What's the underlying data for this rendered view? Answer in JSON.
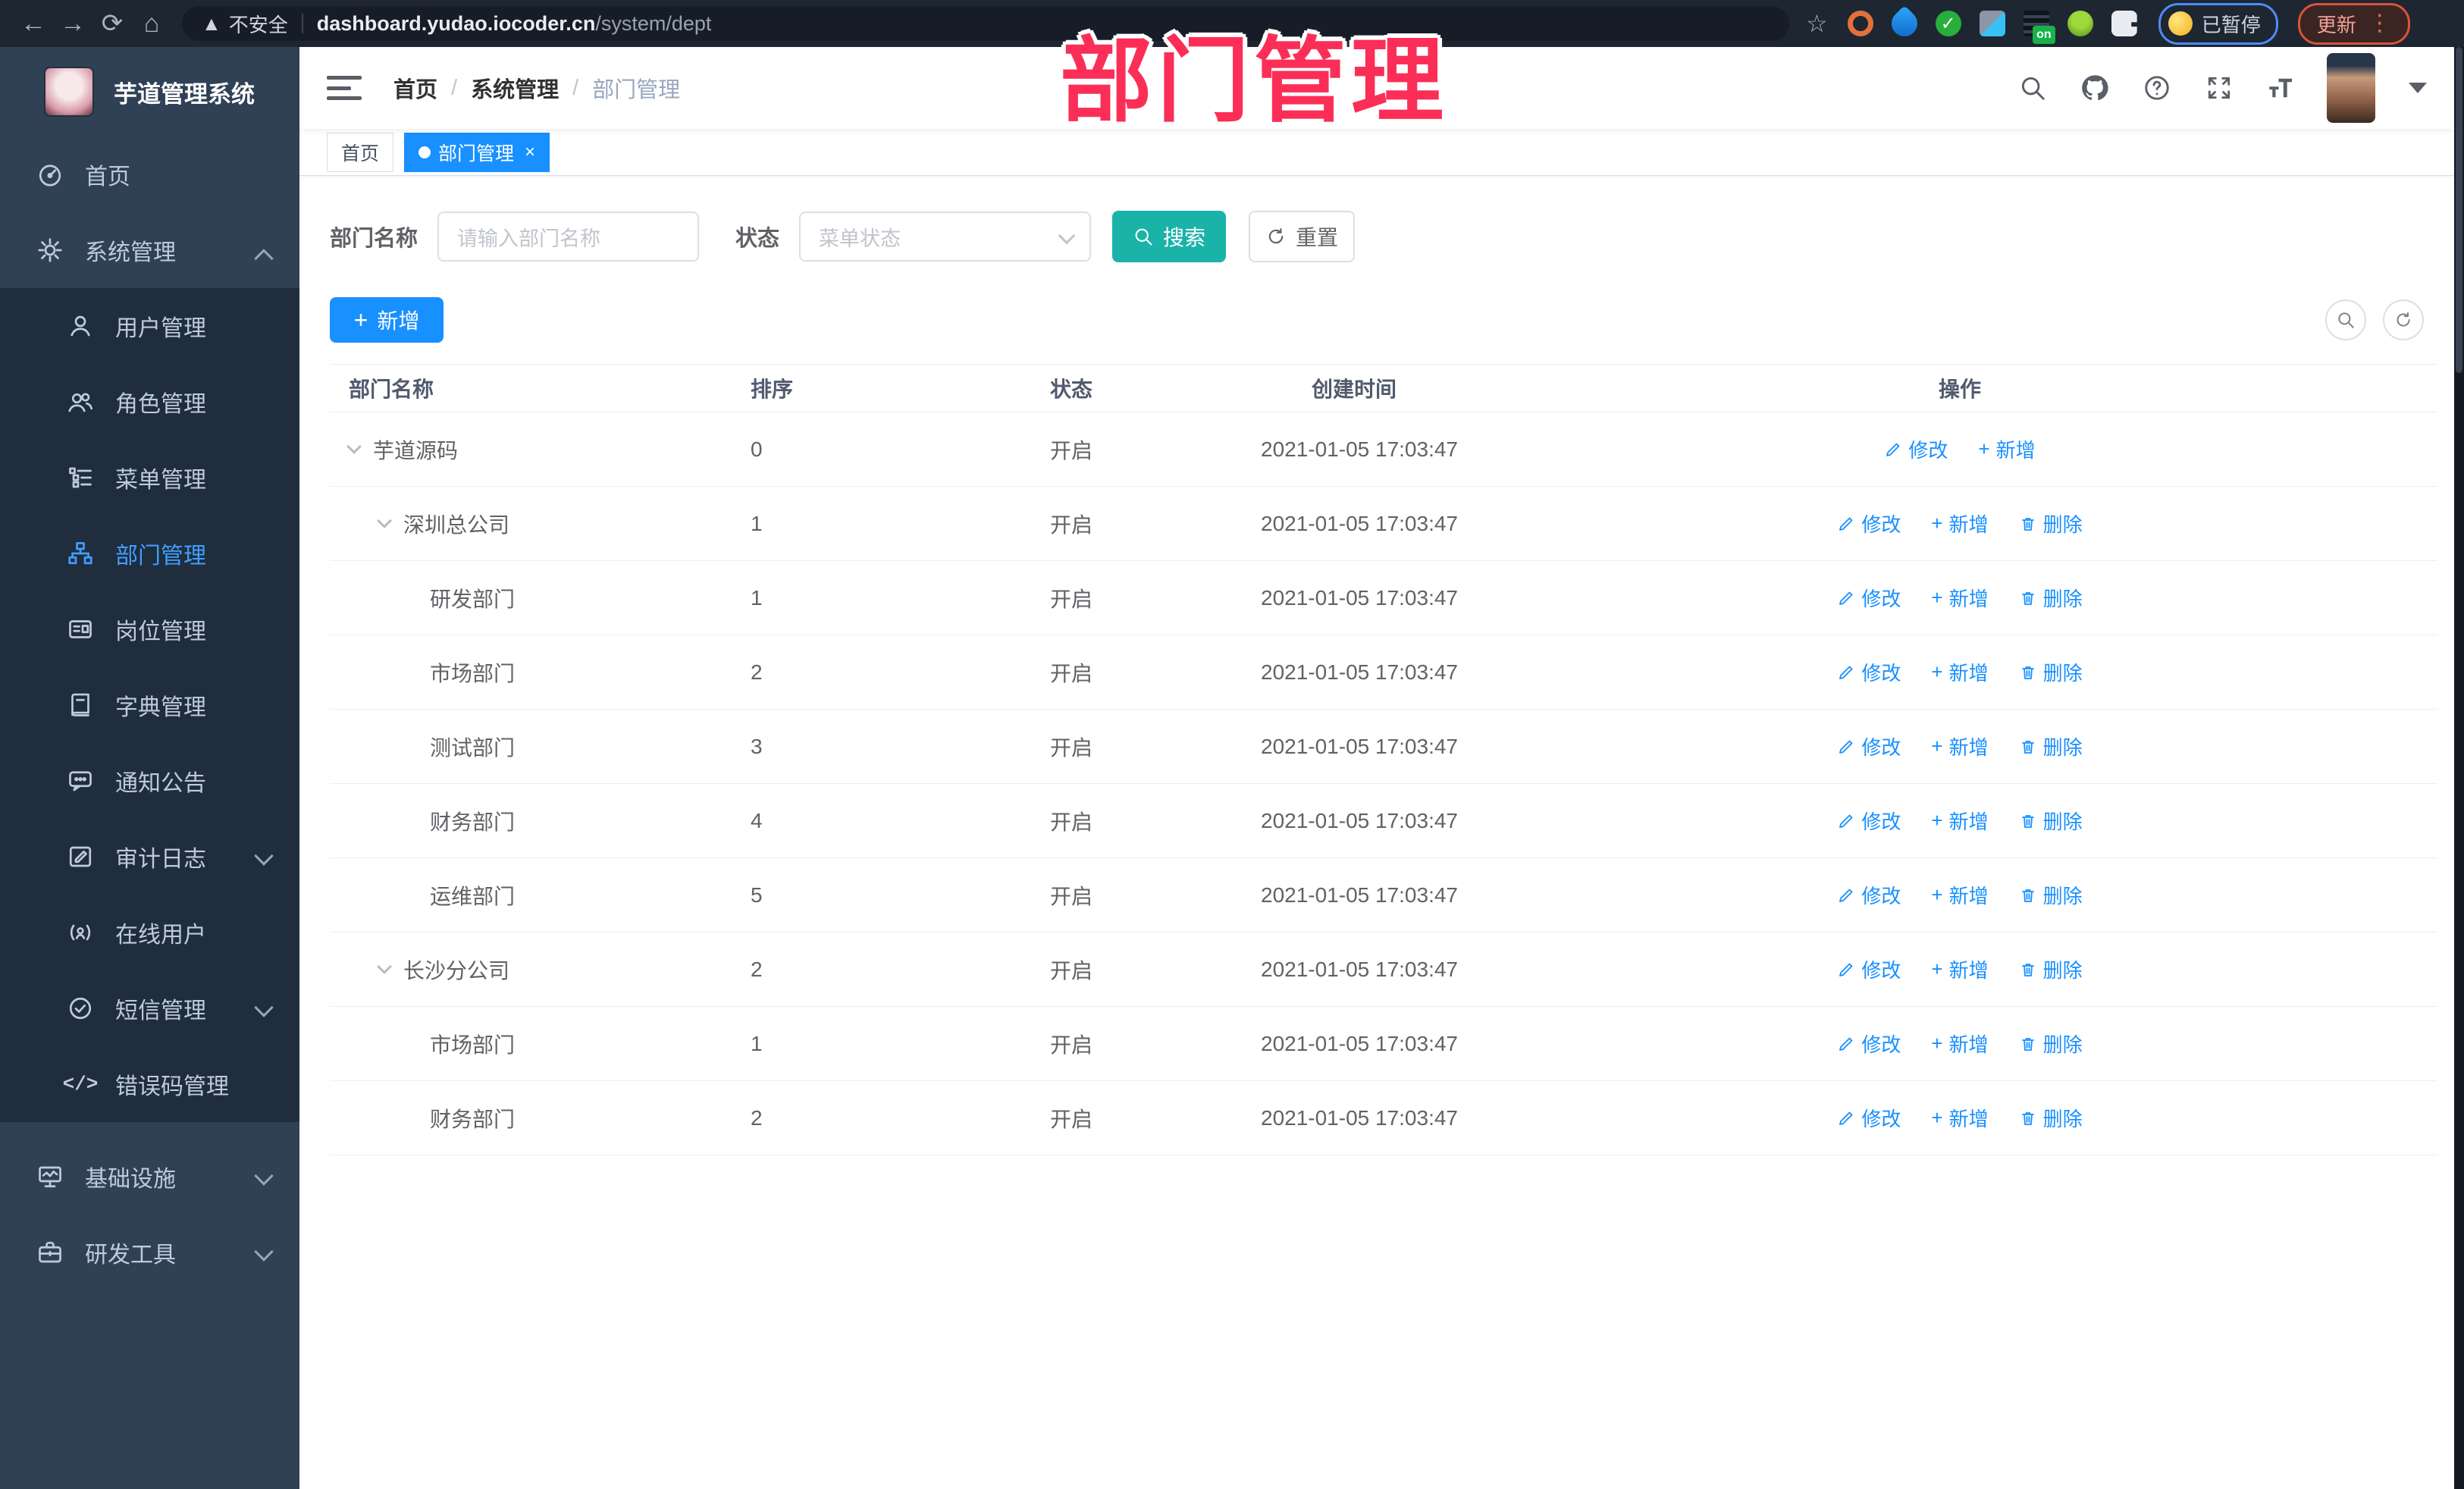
{
  "browser": {
    "security_label": "不安全",
    "url_host": "dashboard.yudao.iocoder.cn",
    "url_path": "/system/dept",
    "paused_badge": "已暂停",
    "update_button": "更新"
  },
  "annotation_title": "部门管理",
  "sidebar": {
    "app_title": "芋道管理系统",
    "menu": [
      {
        "label": "首页",
        "icon": "dashboard-icon"
      },
      {
        "label": "系统管理",
        "icon": "gear-icon",
        "state": "expanded"
      },
      {
        "label": "用户管理",
        "icon": "user-icon"
      },
      {
        "label": "角色管理",
        "icon": "role-icon"
      },
      {
        "label": "菜单管理",
        "icon": "menu-tree-icon"
      },
      {
        "label": "部门管理",
        "icon": "org-tree-icon",
        "active": true
      },
      {
        "label": "岗位管理",
        "icon": "post-icon"
      },
      {
        "label": "字典管理",
        "icon": "dict-icon"
      },
      {
        "label": "通知公告",
        "icon": "notice-icon"
      },
      {
        "label": "审计日志",
        "icon": "audit-icon",
        "state": "collapsed"
      },
      {
        "label": "在线用户",
        "icon": "online-user-icon"
      },
      {
        "label": "短信管理",
        "icon": "sms-icon",
        "state": "collapsed"
      },
      {
        "label": "错误码管理",
        "icon": "error-code-icon"
      },
      {
        "label": "基础设施",
        "icon": "infra-icon",
        "state": "collapsed"
      },
      {
        "label": "研发工具",
        "icon": "devtools-icon",
        "state": "collapsed"
      }
    ]
  },
  "header": {
    "breadcrumb": [
      "首页",
      "系统管理",
      "部门管理"
    ]
  },
  "tags": [
    {
      "label": "首页",
      "active": false
    },
    {
      "label": "部门管理",
      "active": true
    }
  ],
  "filters": {
    "dept_name_label": "部门名称",
    "dept_name_placeholder": "请输入部门名称",
    "status_label": "状态",
    "status_placeholder": "菜单状态",
    "search_button": "搜索",
    "reset_button": "重置"
  },
  "toolbar": {
    "add_button": "新增"
  },
  "table": {
    "columns": {
      "name": "部门名称",
      "sort": "排序",
      "status": "状态",
      "created": "创建时间",
      "action": "操作"
    },
    "action_labels": {
      "edit": "修改",
      "add": "新增",
      "delete": "删除"
    },
    "rows": [
      {
        "name": "芋道源码",
        "sort": "0",
        "status": "开启",
        "created": "2021-01-05 17:03:47",
        "level": 0,
        "expandable": true,
        "deletable": false
      },
      {
        "name": "深圳总公司",
        "sort": "1",
        "status": "开启",
        "created": "2021-01-05 17:03:47",
        "level": 1,
        "expandable": true,
        "deletable": true
      },
      {
        "name": "研发部门",
        "sort": "1",
        "status": "开启",
        "created": "2021-01-05 17:03:47",
        "level": 2,
        "expandable": false,
        "deletable": true
      },
      {
        "name": "市场部门",
        "sort": "2",
        "status": "开启",
        "created": "2021-01-05 17:03:47",
        "level": 2,
        "expandable": false,
        "deletable": true
      },
      {
        "name": "测试部门",
        "sort": "3",
        "status": "开启",
        "created": "2021-01-05 17:03:47",
        "level": 2,
        "expandable": false,
        "deletable": true
      },
      {
        "name": "财务部门",
        "sort": "4",
        "status": "开启",
        "created": "2021-01-05 17:03:47",
        "level": 2,
        "expandable": false,
        "deletable": true
      },
      {
        "name": "运维部门",
        "sort": "5",
        "status": "开启",
        "created": "2021-01-05 17:03:47",
        "level": 2,
        "expandable": false,
        "deletable": true
      },
      {
        "name": "长沙分公司",
        "sort": "2",
        "status": "开启",
        "created": "2021-01-05 17:03:47",
        "level": 1,
        "expandable": true,
        "deletable": true
      },
      {
        "name": "市场部门",
        "sort": "1",
        "status": "开启",
        "created": "2021-01-05 17:03:47",
        "level": 2,
        "expandable": false,
        "deletable": true
      },
      {
        "name": "财务部门",
        "sort": "2",
        "status": "开启",
        "created": "2021-01-05 17:03:47",
        "level": 2,
        "expandable": false,
        "deletable": true
      }
    ]
  },
  "colors": {
    "accent_blue": "#1890ff",
    "search_teal": "#1ab3a8",
    "sidebar_bg": "#304156",
    "submenu_bg": "#1f2d3d",
    "active_menu_text": "#409eff",
    "annotation_pink": "#fb2e57"
  }
}
